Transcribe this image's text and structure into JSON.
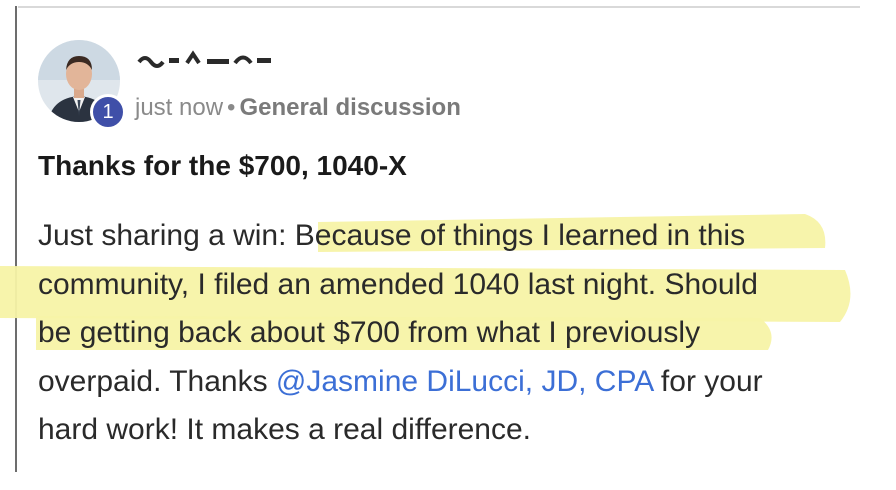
{
  "post": {
    "level_badge": "1",
    "timestamp": "just now",
    "separator": "•",
    "category": "General discussion",
    "title": "Thanks for the $700, 1040-X",
    "body": {
      "line1_plain": "Just sharing a win: ",
      "line1_highlight": "Because of things I learned in this",
      "line2": "community, I filed an amended 1040 last night. Should",
      "line3": "be getting back about $700 from what I previously",
      "line4_before": "overpaid. Thanks ",
      "mention": "@Jasmine DiLucci, JD, CPA",
      "line4_after": " for your",
      "line5": "hard work! It makes a real difference."
    }
  },
  "colors": {
    "highlight": "#f7f3a6",
    "mention": "#3c6fd6",
    "badge": "#3f4fa8",
    "meta_text": "#8a8a8a"
  },
  "icons": {
    "avatar": "user-avatar-photo",
    "redaction": "redacted-name-scribble"
  }
}
